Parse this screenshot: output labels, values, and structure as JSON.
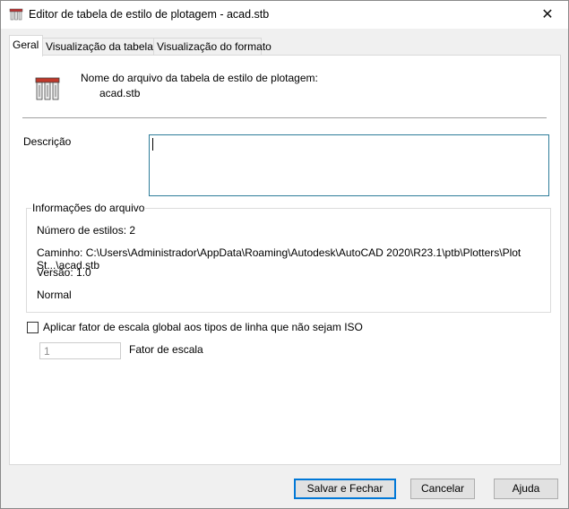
{
  "window": {
    "title": "Editor de tabela de estilo de plotagem - acad.stb",
    "app_icon": "plot-style-table-icon",
    "close_glyph": "✕"
  },
  "tabs": [
    {
      "label": "Geral",
      "active": true
    },
    {
      "label": "Visualização da tabela",
      "active": false
    },
    {
      "label": "Visualização do formato",
      "active": false
    }
  ],
  "general": {
    "file_icon": "plot-style-table-icon",
    "file_name_label": "Nome do arquivo da tabela de estilo de plotagem:",
    "file_name": "acad.stb",
    "description_label": "Descrição",
    "description_value": "",
    "file_info": {
      "legend": "Informações do arquivo",
      "style_count": "Número de estilos: 2",
      "path": "Caminho: C:\\Users\\Administrador\\AppData\\Roaming\\Autodesk\\AutoCAD 2020\\R23.1\\ptb\\Plotters\\Plot St...\\acad.stb",
      "version": "Versão: 1.0",
      "type": "Normal"
    },
    "apply_scale_label": "Aplicar fator de escala global aos tipos de linha que não sejam ISO",
    "apply_scale_checked": false,
    "scale_value": "1",
    "scale_label": "Fator de escala"
  },
  "buttons": {
    "save_close": "Salvar e Fechar",
    "cancel": "Cancelar",
    "help": "Ajuda"
  },
  "colors": {
    "focus_border": "#2e7d9a",
    "default_button_border": "#0078d7"
  }
}
